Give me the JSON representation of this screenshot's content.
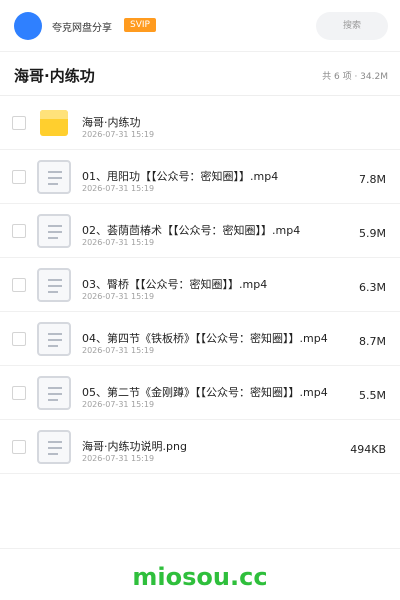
{
  "header": {
    "owner": "夸克网盘分享",
    "badge": "SVIP",
    "search_placeholder": "搜索"
  },
  "title": {
    "text": "海哥·内练功",
    "summary": "共 6 项 · 34.2M"
  },
  "files": [
    {
      "type": "folder",
      "name": "海哥·内练功",
      "date": "2026-07-31 15:19",
      "size": ""
    },
    {
      "type": "file",
      "name": "01、甩阳功【【公众号：密知圈】】.mp4",
      "date": "2026-07-31 15:19",
      "size": "7.8M"
    },
    {
      "type": "file",
      "name": "02、荟荫茴椿术【【公众号：密知圈】】.mp4",
      "date": "2026-07-31 15:19",
      "size": "5.9M"
    },
    {
      "type": "file",
      "name": "03、臀桥【【公众号：密知圈】】.mp4",
      "date": "2026-07-31 15:19",
      "size": "6.3M"
    },
    {
      "type": "file",
      "name": "04、第四节《铁板桥》【【公众号：密知圈】】.mp4",
      "date": "2026-07-31 15:19",
      "size": "8.7M"
    },
    {
      "type": "file",
      "name": "05、第二节《金刚蹲》【【公众号：密知圈】】.mp4",
      "date": "2026-07-31 15:19",
      "size": "5.5M"
    },
    {
      "type": "file",
      "name": "海哥·内练功说明.png",
      "date": "2026-07-31 15:19",
      "size": "494KB"
    }
  ],
  "footer": {
    "brand": "miosou.cc",
    "brand_color": "#2fbf3c"
  },
  "colors": {
    "accent": "#2f80ff",
    "svip": "#ff9b1f",
    "folder": "#ffcf2e"
  }
}
